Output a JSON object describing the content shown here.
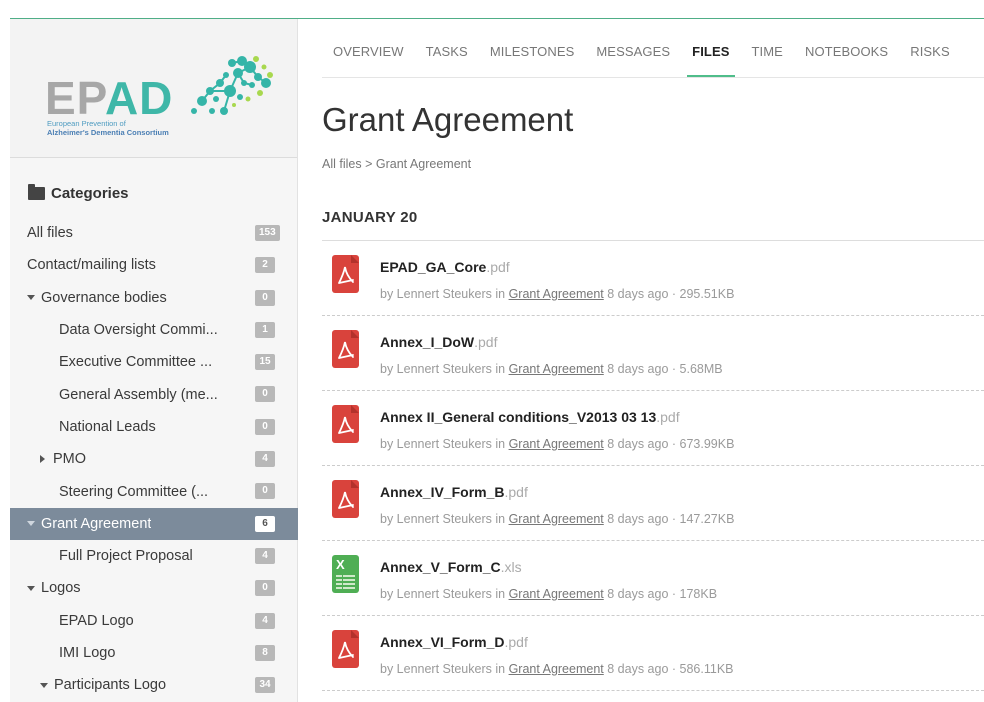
{
  "logo": {
    "wordmark_left": "EP",
    "wordmark_right": "AD",
    "subtitle_line1": "European Prevention of",
    "subtitle_line2": "Alzheimer's Dementia Consortium"
  },
  "sidebar": {
    "header": "Categories",
    "items": [
      {
        "label": "All files",
        "count": "153",
        "indent": 0,
        "caret": ""
      },
      {
        "label": "Contact/mailing lists",
        "count": "2",
        "indent": 0,
        "caret": ""
      },
      {
        "label": "Governance bodies",
        "count": "0",
        "indent": 0,
        "caret": "down"
      },
      {
        "label": "Data Oversight Commi...",
        "count": "1",
        "indent": 1,
        "caret": ""
      },
      {
        "label": "Executive Committee ...",
        "count": "15",
        "indent": 1,
        "caret": ""
      },
      {
        "label": "General Assembly (me...",
        "count": "0",
        "indent": 1,
        "caret": ""
      },
      {
        "label": "National Leads",
        "count": "0",
        "indent": 1,
        "caret": ""
      },
      {
        "label": "PMO",
        "count": "4",
        "indent": 1,
        "caret": "right"
      },
      {
        "label": "Steering Committee (...",
        "count": "0",
        "indent": 1,
        "caret": ""
      },
      {
        "label": "Grant Agreement",
        "count": "6",
        "indent": 0,
        "caret": "down",
        "active": true
      },
      {
        "label": "Full Project Proposal",
        "count": "4",
        "indent": 1,
        "caret": ""
      },
      {
        "label": "Logos",
        "count": "0",
        "indent": 0,
        "caret": "down"
      },
      {
        "label": "EPAD Logo",
        "count": "4",
        "indent": 1,
        "caret": ""
      },
      {
        "label": "IMI Logo",
        "count": "8",
        "indent": 1,
        "caret": ""
      },
      {
        "label": "Participants Logo",
        "count": "34",
        "indent": 1,
        "caret": "down"
      }
    ]
  },
  "tabs": [
    {
      "label": "OVERVIEW"
    },
    {
      "label": "TASKS"
    },
    {
      "label": "MILESTONES"
    },
    {
      "label": "MESSAGES"
    },
    {
      "label": "FILES",
      "active": true
    },
    {
      "label": "TIME"
    },
    {
      "label": "NOTEBOOKS"
    },
    {
      "label": "RISKS"
    }
  ],
  "page": {
    "title": "Grant Agreement",
    "breadcrumb_root": "All files",
    "breadcrumb_sep": ">",
    "breadcrumb_current": "Grant Agreement",
    "date_group": "JANUARY 20"
  },
  "files": [
    {
      "name": "EPAD_GA_Core",
      "ext": ".pdf",
      "type": "pdf",
      "by": "by Lennert Steukers in",
      "category": "Grant Agreement",
      "age": "8 days ago",
      "size": "295.51KB"
    },
    {
      "name": "Annex_I_DoW",
      "ext": ".pdf",
      "type": "pdf",
      "by": "by Lennert Steukers in",
      "category": "Grant Agreement",
      "age": "8 days ago",
      "size": "5.68MB"
    },
    {
      "name": "Annex II_General conditions_V2013 03 13",
      "ext": ".pdf",
      "type": "pdf",
      "by": "by Lennert Steukers in",
      "category": "Grant Agreement",
      "age": "8 days ago",
      "size": "673.99KB"
    },
    {
      "name": "Annex_IV_Form_B",
      "ext": ".pdf",
      "type": "pdf",
      "by": "by Lennert Steukers in",
      "category": "Grant Agreement",
      "age": "8 days ago",
      "size": "147.27KB"
    },
    {
      "name": "Annex_V_Form_C",
      "ext": ".xls",
      "type": "xls",
      "by": "by Lennert Steukers in",
      "category": "Grant Agreement",
      "age": "8 days ago",
      "size": "178KB"
    },
    {
      "name": "Annex_VI_Form_D",
      "ext": ".pdf",
      "type": "pdf",
      "by": "by Lennert Steukers in",
      "category": "Grant Agreement",
      "age": "8 days ago",
      "size": "586.11KB"
    }
  ],
  "colors": {
    "accent": "#4fbd8a",
    "sidebar_active": "#7c8b9b",
    "pdf_icon": "#d9433c",
    "xls_icon": "#4fae54",
    "badge": "#b8b8b8"
  }
}
